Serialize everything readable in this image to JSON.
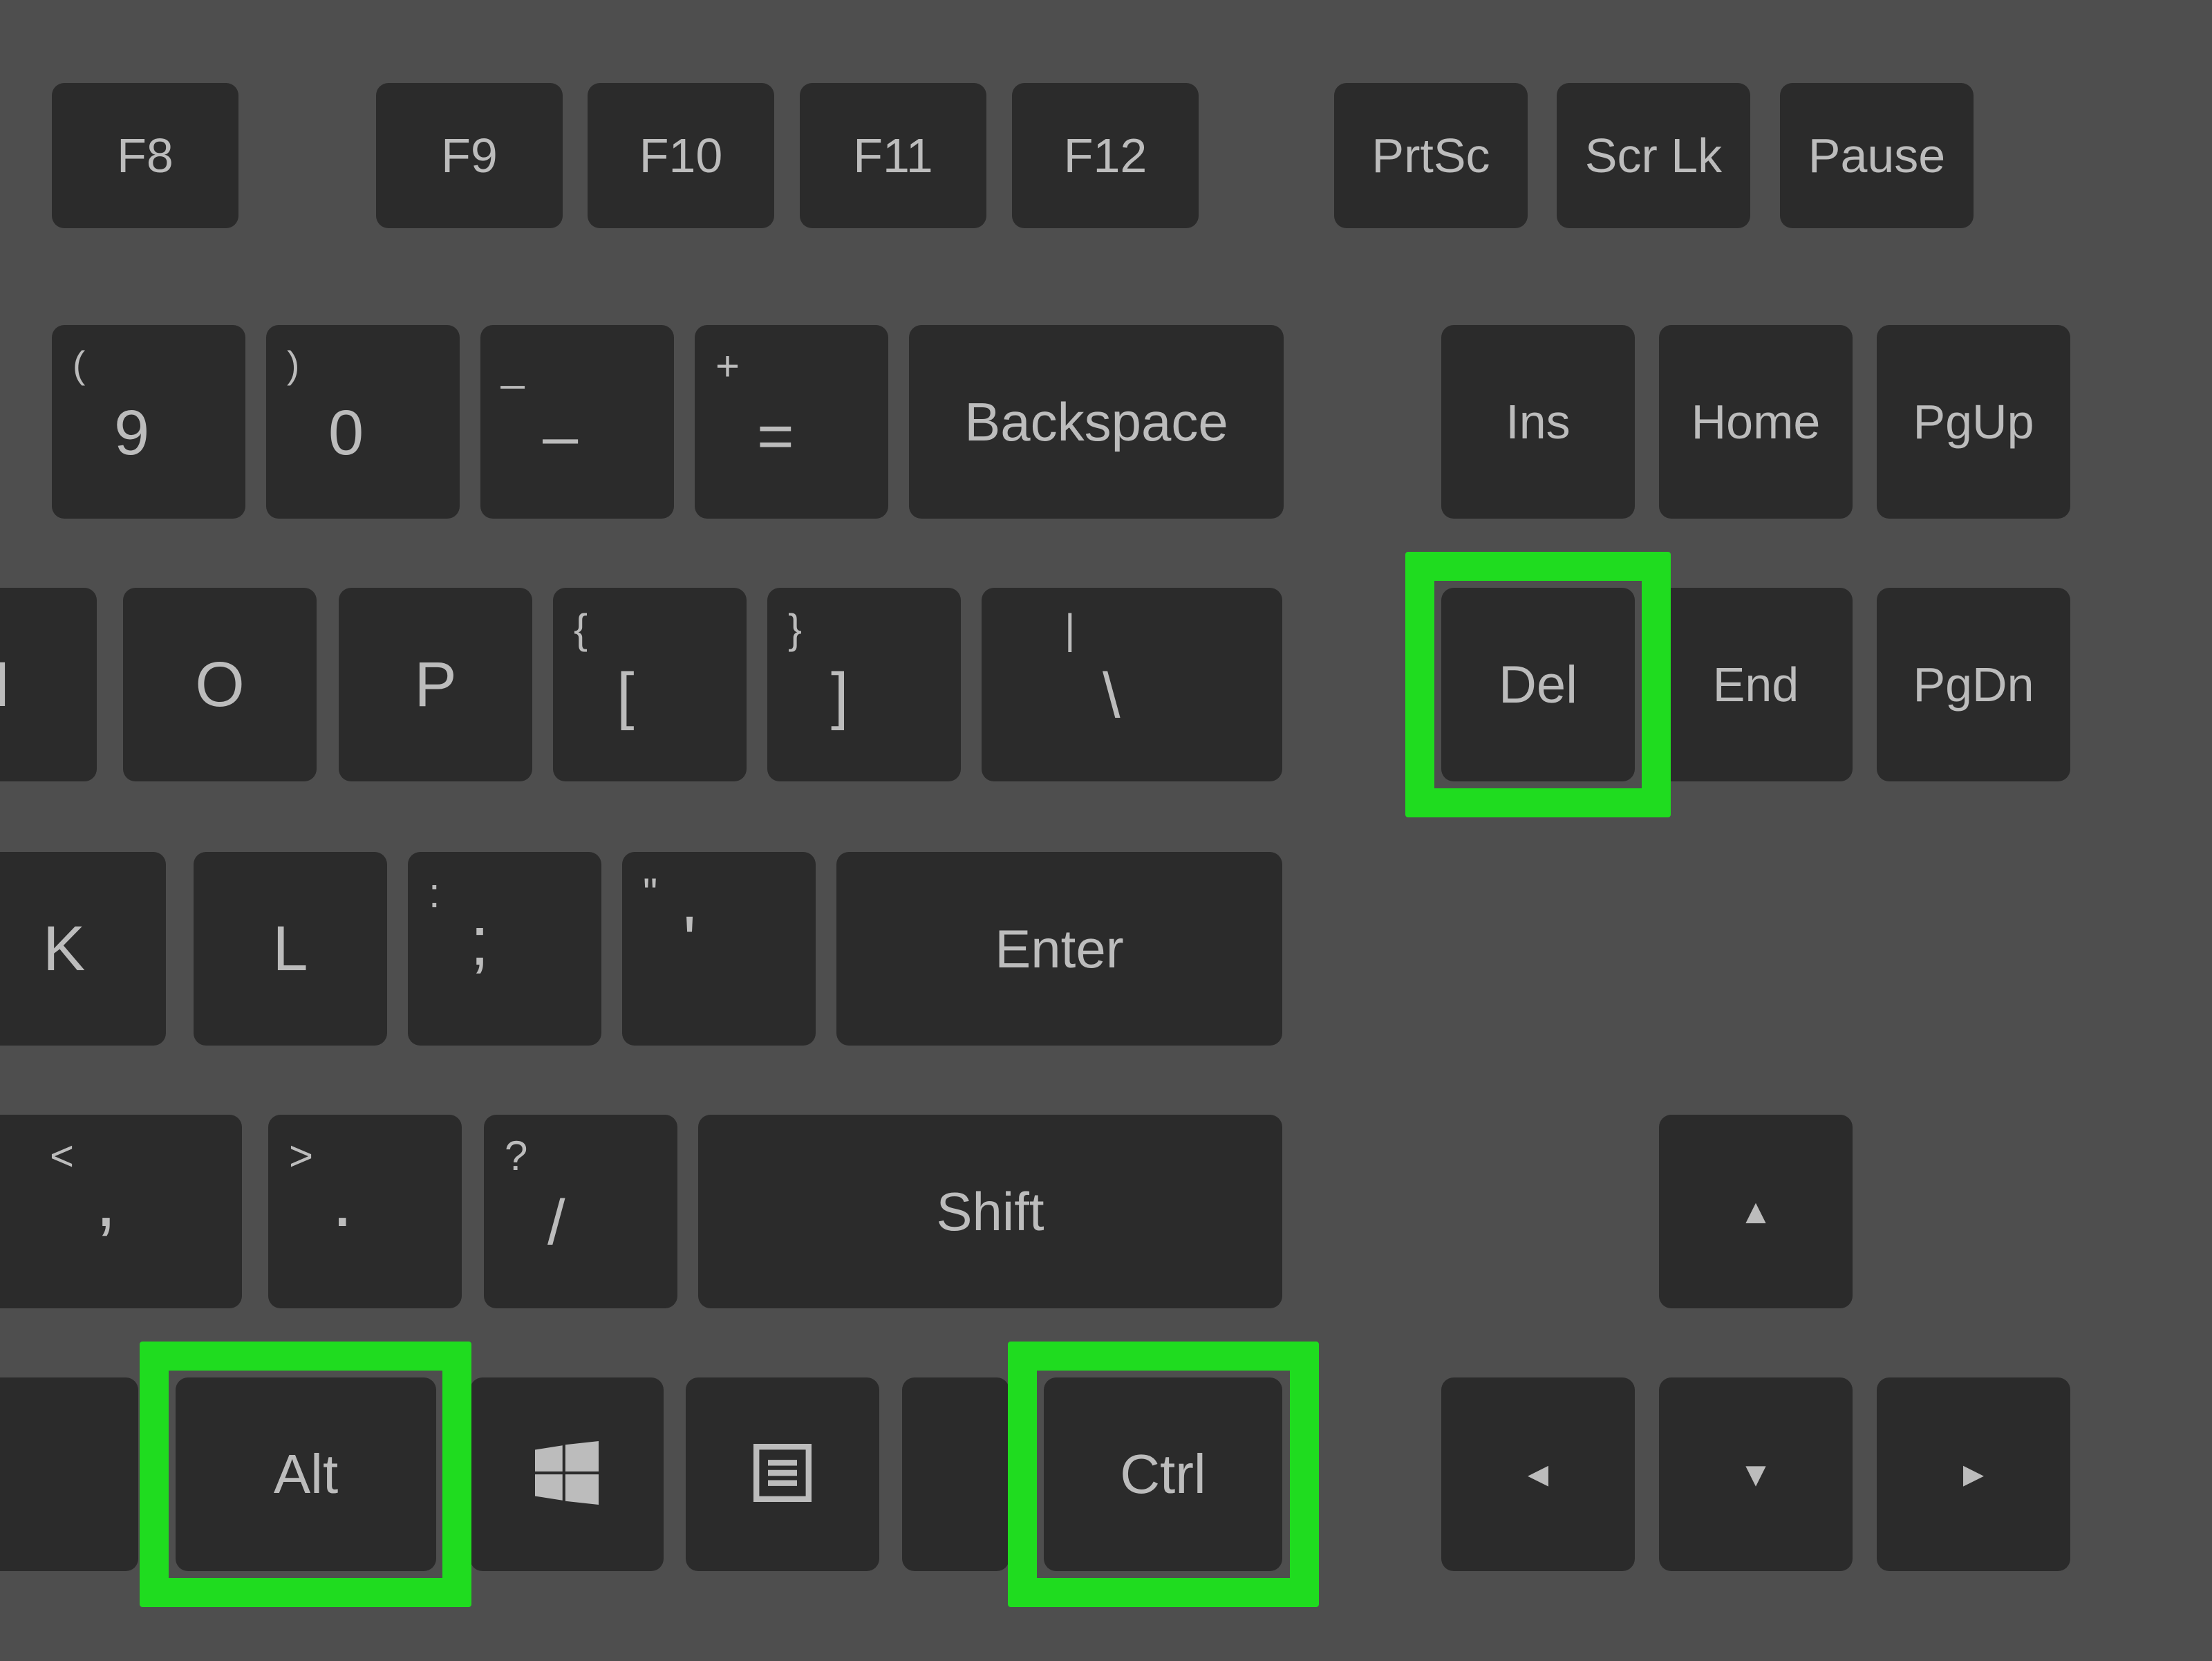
{
  "highlight_color": "#1fdc1f",
  "key_color": "#2b2b2b",
  "text_color": "#bcbcbc",
  "keys": {
    "f8": "F8",
    "f9": "F9",
    "f10": "F10",
    "f11": "F11",
    "f12": "F12",
    "prtsc": "PrtSc",
    "scrlk": "Scr Lk",
    "pause": "Pause",
    "nine_sub": "(",
    "nine": "9",
    "zero_sub": ")",
    "zero": "0",
    "minus_sub": "_",
    "minus": "–",
    "equals_sub": "+",
    "equals": "=",
    "backspace": "Backspace",
    "ins": "Ins",
    "home": "Home",
    "pgup": "PgUp",
    "i": "I",
    "o": "O",
    "p": "P",
    "lbracket_sub": "{",
    "lbracket": "[",
    "rbracket_sub": "}",
    "rbracket": "]",
    "backslash_sub": "|",
    "backslash": "\\",
    "del": "Del",
    "end": "End",
    "pgdn": "PgDn",
    "k": "K",
    "l": "L",
    "semicolon_sub": ":",
    "semicolon": ";",
    "quote_sub": "\"",
    "quote": "'",
    "enter": "Enter",
    "comma_sub": "<",
    "comma": ",",
    "period_sub": ">",
    "period": ".",
    "slash_sub": "?",
    "slash": "/",
    "shift": "Shift",
    "up": "▲",
    "alt": "Alt",
    "ctrl": "Ctrl",
    "left": "◄",
    "down": "▼",
    "right": "►"
  },
  "highlighted_keys": [
    "del",
    "alt",
    "ctrl"
  ]
}
